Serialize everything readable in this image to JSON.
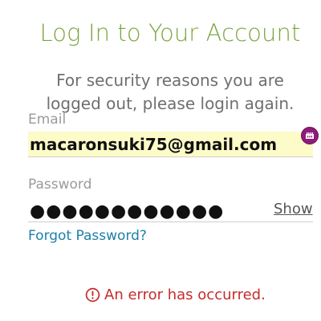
{
  "header": {
    "title": "Log In to Your Account",
    "subtitle": "For security reasons you are logged out, please login again."
  },
  "form": {
    "email_label": "Email",
    "email_value": "macaronsuki75@gmail.com",
    "password_label": "Password",
    "password_value": "●●●●●●●●●●●●",
    "show_label": "Show",
    "forgot_label": "Forgot Password?"
  },
  "error": {
    "message": "An error has occurred.",
    "icon": "alert-circle-icon"
  },
  "icons": {
    "password_manager": "password-manager-icon"
  },
  "colors": {
    "title": "#7ca541",
    "link": "#1e7fa8",
    "error": "#c62b2b",
    "autofill_bg": "#fdfbc7",
    "password_manager": "#8e1c7a"
  }
}
